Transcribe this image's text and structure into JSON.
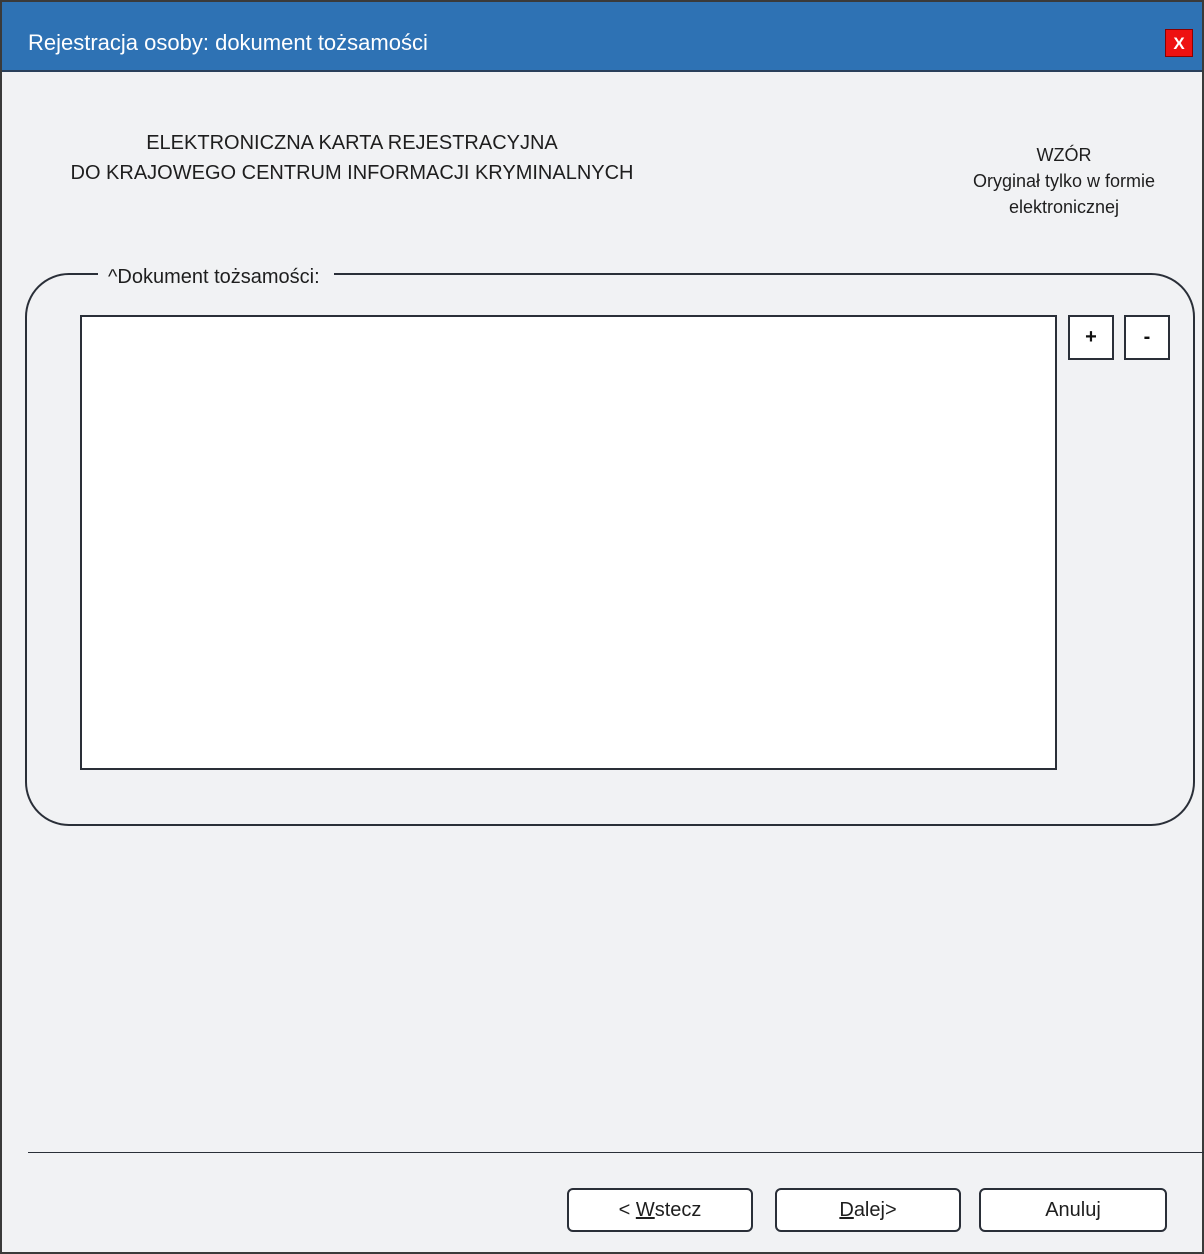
{
  "window": {
    "title": "Rejestracja osoby: dokument tożsamości",
    "close_label": "X"
  },
  "header": {
    "line1": "ELEKTRONICZNA KARTA REJESTRACYJNA",
    "line2": "DO KRAJOWEGO CENTRUM INFORMACJI KRYMINALNYCH",
    "stamp_line1": "WZÓR",
    "stamp_line2": "Oryginał tylko w formie",
    "stamp_line3": "elektronicznej"
  },
  "document_group": {
    "label": "^Dokument tożsamości:",
    "add_label": "+",
    "remove_label": "-",
    "items": []
  },
  "footer": {
    "back_prefix": "< ",
    "back_mnemonic": "W",
    "back_rest": "stecz",
    "next_mnemonic": "D",
    "next_rest": "alej>",
    "cancel_label": "Anuluj"
  },
  "colors": {
    "titlebar": "#2e72b4",
    "close_button": "#ee1111",
    "window_background": "#f1f2f4"
  }
}
